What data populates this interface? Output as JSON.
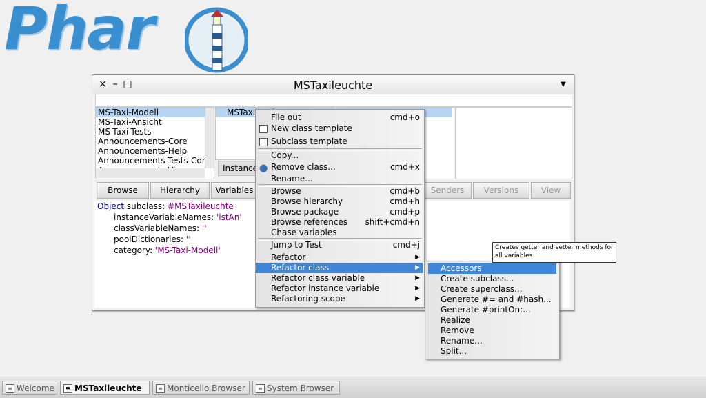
{
  "logo": {
    "text": "Phar"
  },
  "window": {
    "title": "MSTaxileuchte",
    "close_label": "×",
    "minimize_label": "–",
    "maximize_label": "□",
    "menu_label": "▼"
  },
  "packages": [
    "MS-Taxi-Modell",
    "MS-Taxi-Ansicht",
    "MS-Taxi-Tests",
    "Announcements-Core",
    "Announcements-Help",
    "Announcements-Tests-Core",
    "Announcements-View"
  ],
  "class_pane": {
    "selected": "MSTaxileuchte",
    "instance_tab": "Instance"
  },
  "buttons": {
    "browse": "Browse",
    "hierarchy": "Hierarchy",
    "variables": "Variables",
    "senders": "Senders",
    "versions": "Versions",
    "view": "View"
  },
  "code": {
    "l1_a": "Object",
    "l1_b": " subclass: ",
    "l1_c": "#MSTaxileuchte",
    "l2_a": "instanceVariableNames: ",
    "l2_b": "'istAn'",
    "l3_a": "classVariableNames: ",
    "l3_b": "''",
    "l4_a": "poolDictionaries: ",
    "l4_b": "''",
    "l5_a": "category: ",
    "l5_b": "'MS-Taxi-Modell'"
  },
  "context_menu": {
    "items": [
      {
        "label": "File out",
        "shortcut": "cmd+o"
      },
      {
        "label": "New class template",
        "shortcut": ""
      },
      {
        "label": "Subclass template",
        "shortcut": ""
      },
      {
        "label": "Copy...",
        "shortcut": ""
      },
      {
        "label": "Remove class...",
        "shortcut": "cmd+x"
      },
      {
        "label": "Rename...",
        "shortcut": ""
      },
      {
        "label": "Browse",
        "shortcut": "cmd+b"
      },
      {
        "label": "Browse hierarchy",
        "shortcut": "cmd+h"
      },
      {
        "label": "Browse package",
        "shortcut": "cmd+p"
      },
      {
        "label": "Browse references",
        "shortcut": "shift+cmd+n"
      },
      {
        "label": "Chase variables",
        "shortcut": ""
      },
      {
        "label": "Jump to Test",
        "shortcut": "cmd+j"
      },
      {
        "label": "Refactor",
        "shortcut": ""
      },
      {
        "label": "Refactor class",
        "shortcut": ""
      },
      {
        "label": "Refactor class variable",
        "shortcut": ""
      },
      {
        "label": "Refactor instance variable",
        "shortcut": ""
      },
      {
        "label": "Refactoring scope",
        "shortcut": ""
      }
    ]
  },
  "submenu": {
    "items": [
      "Accessors",
      "Create subclass...",
      "Create superclass...",
      "Generate #= and #hash...",
      "Generate #printOn:...",
      "Realize",
      "Remove",
      "Rename...",
      "Split..."
    ]
  },
  "tooltip": {
    "text": "Creates getter and setter methods for all variables."
  },
  "taskbar": {
    "tasks": [
      "Welcome",
      "MSTaxileuchte",
      "Monticello Browser",
      "System Browser"
    ]
  },
  "colors": {
    "highlight": "#3f86d8",
    "selection": "#b4d4f2",
    "logo": "#3a8fd0"
  }
}
